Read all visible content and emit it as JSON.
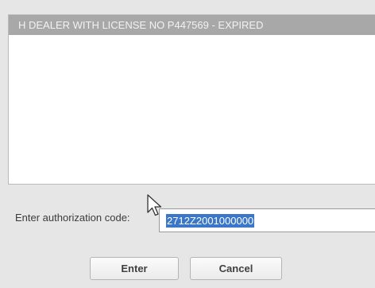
{
  "messages": [
    {
      "text": "H  DEALER WITH LICENSE NO P447569 - EXPIRED"
    }
  ],
  "authorization": {
    "label": "Enter authorization code:",
    "value": "2712Z2001000000"
  },
  "buttons": {
    "enter_label": "Enter",
    "cancel_label": "Cancel"
  },
  "icons": {
    "cursor": "mouse-pointer-icon"
  }
}
